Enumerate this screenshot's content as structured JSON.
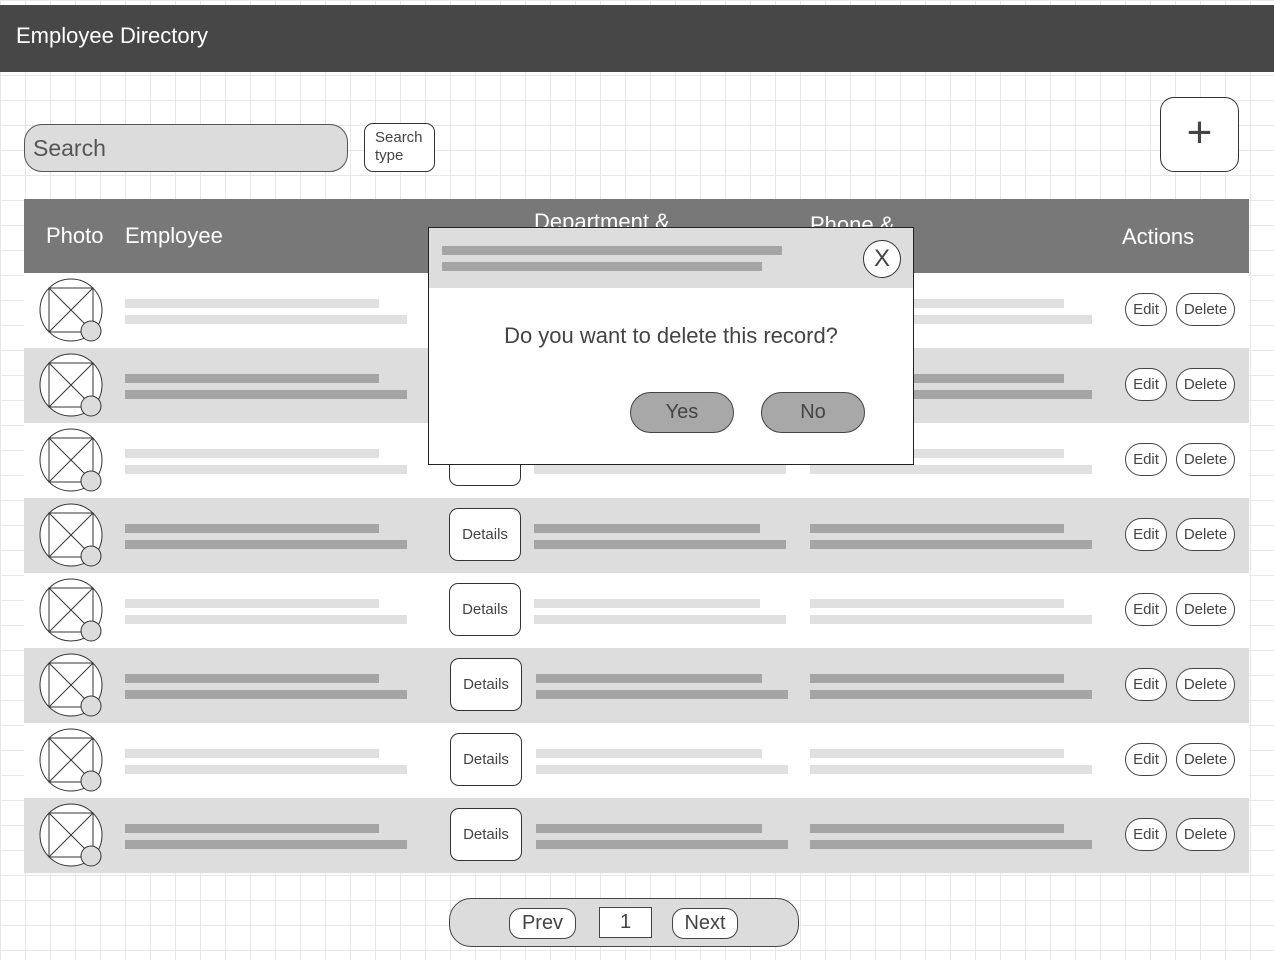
{
  "app": {
    "title": "Employee Directory"
  },
  "toolbar": {
    "search_placeholder": "Search",
    "search_type_label": "Search type",
    "add_label": "+"
  },
  "table": {
    "columns": {
      "photo": "Photo",
      "employee": "Employee",
      "department": "Department &",
      "phone": "Phone &",
      "actions": "Actions"
    },
    "details_label": "Details",
    "edit_label": "Edit",
    "delete_label": "Delete",
    "row_count": 8
  },
  "pagination": {
    "prev_label": "Prev",
    "page": "1",
    "next_label": "Next"
  },
  "modal": {
    "message": "Do you want to delete this record?",
    "yes_label": "Yes",
    "no_label": "No",
    "close_label": "X"
  },
  "icons": {
    "photo": "image-placeholder-icon",
    "add": "plus-icon",
    "close": "close-icon"
  },
  "colors": {
    "header_bar": "#474747",
    "table_header": "#787878",
    "shaded_row": "#dddddd",
    "button_gray": "#a8a8a8"
  }
}
